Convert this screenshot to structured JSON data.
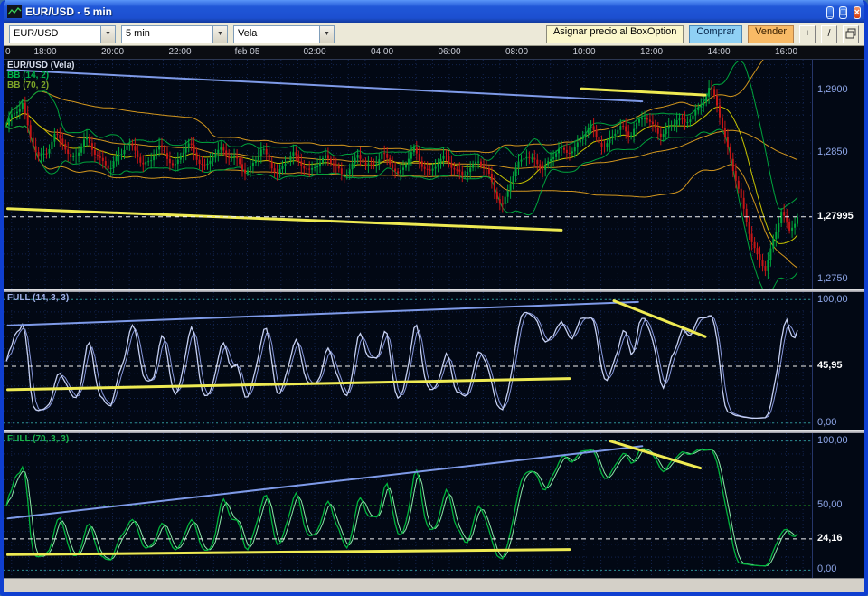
{
  "window": {
    "title": "EUR/USD - 5 min"
  },
  "toolbar": {
    "symbol": "EUR/USD",
    "interval": "5 min",
    "chart_type": "Vela",
    "assign_label": "Asignar precio al BoxOption",
    "buy_label": "Comprar",
    "sell_label": "Vender"
  },
  "time_axis": {
    "labels": [
      "0",
      "18:00",
      "20:00",
      "22:00",
      "feb 05",
      "02:00",
      "04:00",
      "06:00",
      "08:00",
      "10:00",
      "12:00",
      "14:00",
      "16:00"
    ]
  },
  "colors": {
    "plot_bg": "#020814",
    "grid": "#13234d",
    "axis_text": "#8ea6e8",
    "candle_up": "#00a43c",
    "candle_down": "#c41616",
    "bb_fast": "#00a43c",
    "bb_fast_mid": "#c8c400",
    "bb_slow": "#d2961e",
    "stoch_fast_k": "#c6d0f2",
    "stoch_fast_d": "#8898dc",
    "stoch_slow_k": "#00b43c",
    "stoch_slow_d": "#8ce8a8",
    "trend_blue": "#7e9ae8",
    "trend_yellow": "#eeea52",
    "current_line": "#f2f2f2",
    "level_teal": "#2c8f8f",
    "level_green": "#1fa01f",
    "buy_bg": "#8fd0f4",
    "sell_bg": "#f8ba66"
  },
  "chart_data": [
    {
      "type": "candlestick",
      "title": "EUR/USD (Vela)",
      "indicators": [
        "BB (14, 2)",
        "BB (70, 2)"
      ],
      "ylim": [
        1.2742,
        1.2924
      ],
      "yticks": [
        {
          "value": 1.29,
          "label": "1,2900"
        },
        {
          "value": 1.285,
          "label": "1,2850"
        },
        {
          "value": 1.275,
          "label": "1,2750"
        }
      ],
      "current": {
        "value": 1.27995,
        "label": "1,27995"
      },
      "closes": [
        1.2872,
        1.288,
        1.2892,
        1.2862,
        1.2845,
        1.2852,
        1.2864,
        1.2858,
        1.2846,
        1.2852,
        1.286,
        1.2852,
        1.2844,
        1.2836,
        1.2848,
        1.2858,
        1.2852,
        1.284,
        1.2846,
        1.2854,
        1.2848,
        1.284,
        1.285,
        1.2856,
        1.2846,
        1.2838,
        1.2848,
        1.2855,
        1.2847,
        1.2842,
        1.2835,
        1.2844,
        1.2852,
        1.2843,
        1.2834,
        1.2842,
        1.285,
        1.2842,
        1.2833,
        1.2842,
        1.2849,
        1.284,
        1.2831,
        1.284,
        1.2848,
        1.2839,
        1.2843,
        1.2849,
        1.2841,
        1.2834,
        1.2843,
        1.2851,
        1.2842,
        1.2835,
        1.2841,
        1.2848,
        1.2839,
        1.283,
        1.2838,
        1.2846,
        1.2836,
        1.2822,
        1.2808,
        1.2824,
        1.284,
        1.2851,
        1.2843,
        1.2836,
        1.2845,
        1.2854,
        1.2848,
        1.2855,
        1.2862,
        1.287,
        1.2862,
        1.2855,
        1.2864,
        1.2872,
        1.2865,
        1.2872,
        1.288,
        1.2872,
        1.2862,
        1.287,
        1.288,
        1.2872,
        1.288,
        1.289,
        1.2902,
        1.2886,
        1.2862,
        1.2836,
        1.281,
        1.2788,
        1.2768,
        1.2756,
        1.2782,
        1.2806,
        1.2786,
        1.27995
      ],
      "trendlines": [
        {
          "x1": 0.005,
          "y1": 1.2916,
          "x2": 0.79,
          "y2": 1.2891,
          "color": "trend_blue",
          "w": 2
        },
        {
          "x1": 0.715,
          "y1": 1.2901,
          "x2": 0.868,
          "y2": 1.2896,
          "color": "trend_yellow",
          "w": 3
        },
        {
          "x1": 0.005,
          "y1": 1.2806,
          "x2": 0.69,
          "y2": 1.2789,
          "color": "trend_yellow",
          "w": 3
        }
      ]
    },
    {
      "type": "line",
      "title": "FULL (14, 3, 3)",
      "period": 14,
      "ylim": [
        -6,
        106
      ],
      "levels": [
        0,
        100
      ],
      "yticks": [
        {
          "value": 100,
          "label": "100,00"
        },
        {
          "value": 0,
          "label": "0,00"
        }
      ],
      "current": {
        "value": 45.95,
        "label": "45,95"
      },
      "trendlines": [
        {
          "x1": 0.005,
          "y1": 79,
          "x2": 0.785,
          "y2": 98,
          "color": "trend_blue",
          "w": 2
        },
        {
          "x1": 0.005,
          "y1": 27,
          "x2": 0.7,
          "y2": 36,
          "color": "trend_yellow",
          "w": 3
        },
        {
          "x1": 0.755,
          "y1": 99,
          "x2": 0.868,
          "y2": 70,
          "color": "trend_yellow",
          "w": 3
        }
      ]
    },
    {
      "type": "line",
      "title": "FULL (70, 3, 3)",
      "period": 70,
      "ylim": [
        -6,
        106
      ],
      "levels": [
        0,
        100
      ],
      "mid_level": 50,
      "yticks": [
        {
          "value": 100,
          "label": "100,00"
        },
        {
          "value": 50,
          "label": "50,00"
        },
        {
          "value": 0,
          "label": "0,00"
        }
      ],
      "current": {
        "value": 24.16,
        "label": "24,16"
      },
      "trendlines": [
        {
          "x1": 0.005,
          "y1": 40,
          "x2": 0.79,
          "y2": 96,
          "color": "trend_blue",
          "w": 2
        },
        {
          "x1": 0.005,
          "y1": 12,
          "x2": 0.7,
          "y2": 16,
          "color": "trend_yellow",
          "w": 3
        },
        {
          "x1": 0.75,
          "y1": 100,
          "x2": 0.862,
          "y2": 79,
          "color": "trend_yellow",
          "w": 3
        }
      ]
    }
  ]
}
